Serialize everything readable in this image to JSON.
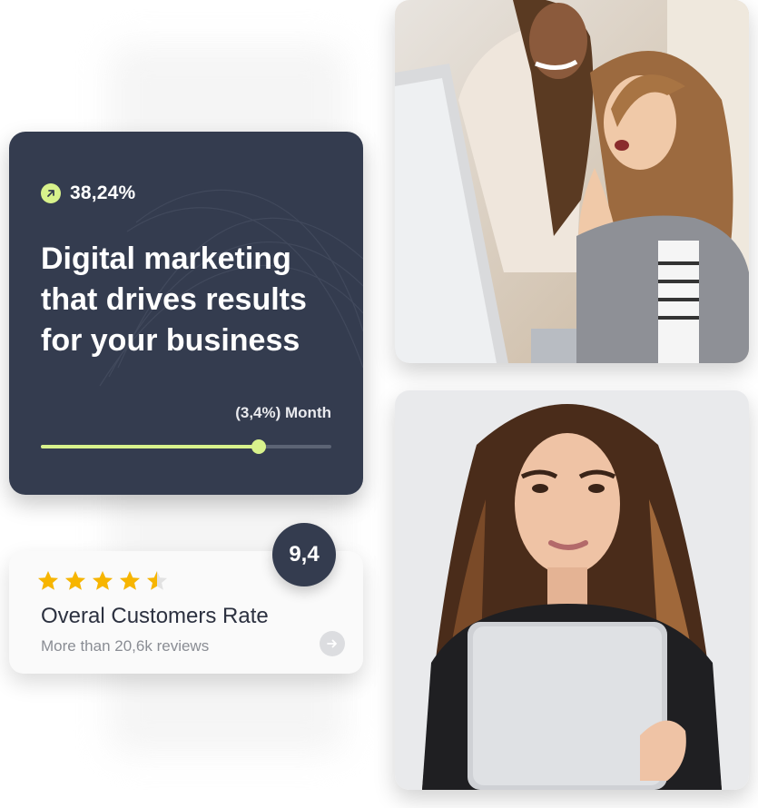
{
  "stat_card": {
    "growth_value": "38,24%",
    "headline": "Digital marketing that drives results for your business",
    "period_label": "(3,4%) Month",
    "progress_percent": 75
  },
  "rating_card": {
    "stars": 4.5,
    "title": "Overal Customers Rate",
    "subtitle": "More than 20,6k reviews",
    "score": "9,4"
  },
  "colors": {
    "card_dark": "#343c4f",
    "accent_lime": "#d8f28c",
    "star_gold": "#f7b500"
  },
  "icons": {
    "growth": "arrow-up-right-icon",
    "more": "arrow-right-icon"
  }
}
